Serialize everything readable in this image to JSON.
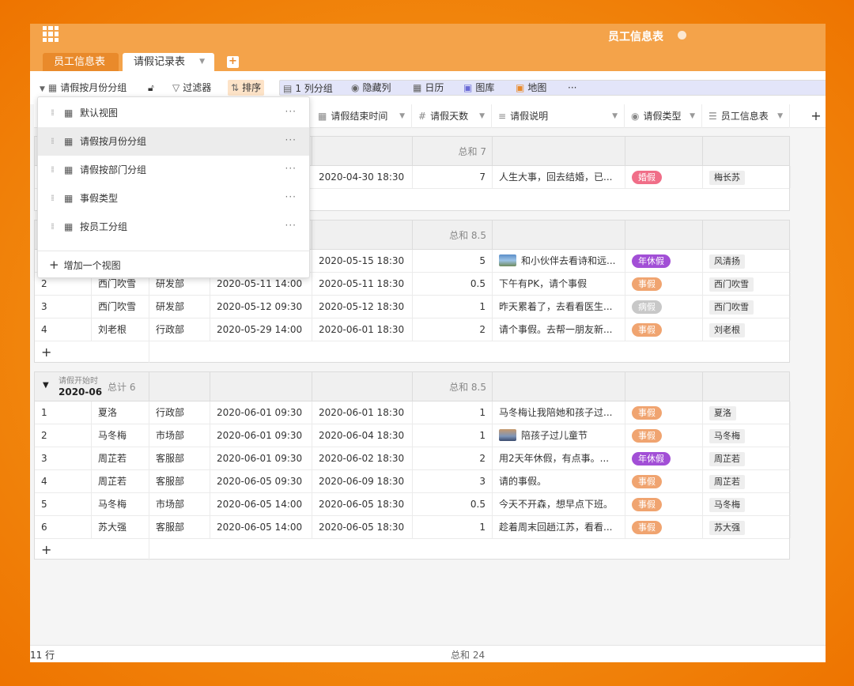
{
  "colors": {
    "accent": "#f4a34a",
    "tab_inactive": "#e98a2b",
    "marriage": "#f06e88",
    "annual": "#a24fd6",
    "personal": "#f0a470",
    "sick": "#c8c8c8"
  },
  "app": {
    "title": "员工信息表"
  },
  "tabs": [
    {
      "label": "员工信息表"
    },
    {
      "label": "请假记录表"
    }
  ],
  "toolbar": {
    "view": "请假按月份分组",
    "filter": "过滤器",
    "sort": "排序",
    "group": "1 列分组",
    "hide": "隐藏列",
    "calendar": "日历",
    "gallery": "图库",
    "map": "地图",
    "more": "···"
  },
  "columns": {
    "end_time": "请假结束时间",
    "days": "请假天数",
    "desc": "请假说明",
    "type": "请假类型",
    "employee": "员工信息表",
    "add": "+"
  },
  "dropdown": {
    "views": [
      "默认视图",
      "请假按月份分组",
      "请假按部门分组",
      "事假类型",
      "按员工分组"
    ],
    "more": "···",
    "add_label": "增加一个视图",
    "add_icon": "+"
  },
  "groups": [
    {
      "sum": "总和 7",
      "rows": [
        {
          "end": "2020-04-30 18:30",
          "days": "7",
          "desc": "人生大事，回去结婚，已...",
          "type": "婚假",
          "type_color": "#f06e88",
          "emp": "梅长苏"
        }
      ]
    },
    {
      "sum": "总和 8.5",
      "rows": [
        {
          "idx": "",
          "name": "",
          "dept": "",
          "start": "",
          "end": "2020-05-15 18:30",
          "days": "5",
          "desc": "和小伙伴去看诗和远...",
          "thumb": true,
          "type": "年休假",
          "type_color": "#a24fd6",
          "emp": "风清扬"
        },
        {
          "idx": "2",
          "name": "西门吹雪",
          "dept": "研发部",
          "start": "2020-05-11 14:00",
          "end": "2020-05-11 18:30",
          "days": "0.5",
          "desc": "下午有PK，请个事假",
          "type": "事假",
          "type_color": "#f0a470",
          "emp": "西门吹雪"
        },
        {
          "idx": "3",
          "name": "西门吹雪",
          "dept": "研发部",
          "start": "2020-05-12 09:30",
          "end": "2020-05-12 18:30",
          "days": "1",
          "desc": "昨天累着了，去看看医生...",
          "type": "病假",
          "type_color": "#c8c8c8",
          "emp": "西门吹雪"
        },
        {
          "idx": "4",
          "name": "刘老根",
          "dept": "行政部",
          "start": "2020-05-29 14:00",
          "end": "2020-06-01 18:30",
          "days": "2",
          "desc": "请个事假。去帮一朋友新...",
          "type": "事假",
          "type_color": "#f0a470",
          "emp": "刘老根"
        }
      ]
    },
    {
      "label_small": "请假开始时",
      "label_big": "2020-06",
      "count": "总计 6",
      "sum": "总和 8.5",
      "rows": [
        {
          "idx": "1",
          "name": "夏洛",
          "dept": "行政部",
          "start": "2020-06-01 09:30",
          "end": "2020-06-01 18:30",
          "days": "1",
          "desc": "马冬梅让我陪她和孩子过...",
          "type": "事假",
          "type_color": "#f0a470",
          "emp": "夏洛"
        },
        {
          "idx": "2",
          "name": "马冬梅",
          "dept": "市场部",
          "start": "2020-06-01 09:30",
          "end": "2020-06-04 18:30",
          "days": "1",
          "desc": "陪孩子过儿童节",
          "thumb": true,
          "type": "事假",
          "type_color": "#f0a470",
          "emp": "马冬梅"
        },
        {
          "idx": "3",
          "name": "周芷若",
          "dept": "客服部",
          "start": "2020-06-01 09:30",
          "end": "2020-06-02 18:30",
          "days": "2",
          "desc": "用2天年休假，有点事。...",
          "type": "年休假",
          "type_color": "#a24fd6",
          "emp": "周芷若"
        },
        {
          "idx": "4",
          "name": "周芷若",
          "dept": "客服部",
          "start": "2020-06-05 09:30",
          "end": "2020-06-09 18:30",
          "days": "3",
          "desc": "请的事假。",
          "type": "事假",
          "type_color": "#f0a470",
          "emp": "周芷若"
        },
        {
          "idx": "5",
          "name": "马冬梅",
          "dept": "市场部",
          "start": "2020-06-05 14:00",
          "end": "2020-06-05 18:30",
          "days": "0.5",
          "desc": "今天不开森，想早点下班。",
          "type": "事假",
          "type_color": "#f0a470",
          "emp": "马冬梅"
        },
        {
          "idx": "6",
          "name": "苏大强",
          "dept": "客服部",
          "start": "2020-06-05 14:00",
          "end": "2020-06-05 18:30",
          "days": "1",
          "desc": "趁着周末回趟江苏，看看...",
          "type": "事假",
          "type_color": "#f0a470",
          "emp": "苏大强"
        }
      ]
    }
  ],
  "footer": {
    "rows": "11 行",
    "total": "总和 24"
  }
}
